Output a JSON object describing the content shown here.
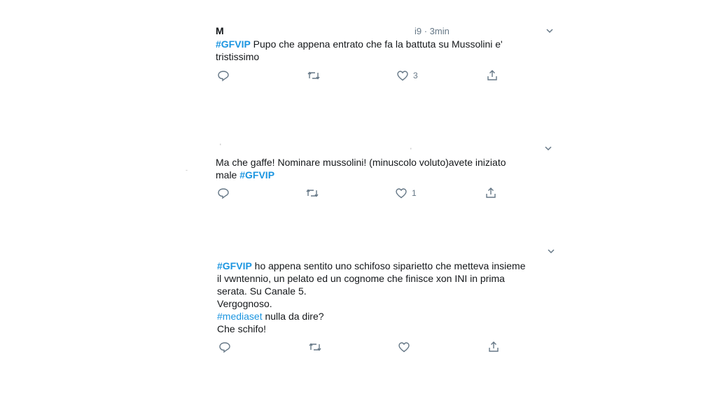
{
  "tweets": [
    {
      "name": "M",
      "meta": "i9 · 3min",
      "hashtag": "#GFVIP",
      "text_lines": [
        " Pupo che appena entrato che fa la battuta su Mussolini e'",
        "tristissimo"
      ],
      "counts": {
        "reply": "",
        "retweet": "",
        "like": "3",
        "share": ""
      }
    },
    {
      "line1": "Ma che gaffe! Nominare mussolini! (minuscolo voluto)avete iniziato",
      "line2_prefix": "male ",
      "hashtag": "#GFVIP",
      "counts": {
        "reply": "",
        "retweet": "",
        "like": "1",
        "share": ""
      }
    },
    {
      "hashtag": "#GFVIP",
      "lines": [
        " ho appena sentito uno schifoso siparietto che metteva insieme",
        "il vwntennio, un pelato ed un cognome che finisce xon INI in prima",
        "serata. Su Canale 5.",
        "Vergognoso."
      ],
      "mention_tag": "#mediaset",
      "after_mention": " nulla da dire?",
      "last_line": "Che schifo!",
      "counts": {
        "reply": "",
        "retweet": "",
        "like": "",
        "share": ""
      }
    }
  ],
  "icons": [
    "reply-icon",
    "retweet-icon",
    "like-icon",
    "share-icon",
    "chevron-down-icon"
  ],
  "colors": {
    "text": "#14171a",
    "hashtag": "#1b95e0",
    "muted": "#657786"
  }
}
